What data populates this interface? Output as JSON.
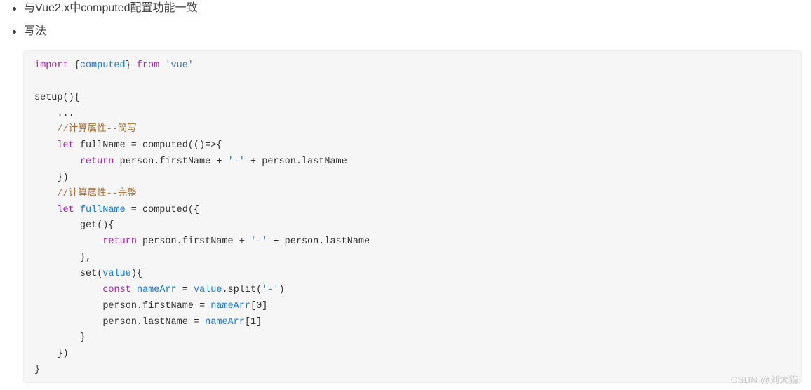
{
  "colors": {
    "page_background": "#ffffff",
    "code_background": "#f6f6f6",
    "code_border": "#eeeeee",
    "text": "#3f3f3f",
    "token_keyword": "#a626a4",
    "token_identifier": "#1a7bd4",
    "token_string": "#3d7ca8",
    "token_comment": "#a0703a",
    "token_plain": "#333333",
    "watermark": "#c9c9c9"
  },
  "notes": {
    "bullets": [
      "与Vue2.x中computed配置功能一致",
      "写法"
    ]
  },
  "code": {
    "language": "javascript",
    "raw": "import {computed} from 'vue'\n\nsetup(){\n    ...\n    //计算属性--简写\n    let fullName = computed(()=>{\n        return person.firstName + '-' + person.lastName\n    })\n    //计算属性--完整\n    let fullName = computed({\n        get(){\n            return person.firstName + '-' + person.lastName\n        },\n        set(value){\n            const nameArr = value.split('-')\n            person.firstName = nameArr[0]\n            person.lastName = nameArr[1]\n        }\n    })\n}",
    "lines": [
      {
        "n": 1,
        "text": "import {computed} from 'vue'"
      },
      {
        "n": 2,
        "text": ""
      },
      {
        "n": 3,
        "text": "setup(){"
      },
      {
        "n": 4,
        "text": "    ..."
      },
      {
        "n": 5,
        "text": "    //计算属性--简写"
      },
      {
        "n": 6,
        "text": "    let fullName = computed(()=>{"
      },
      {
        "n": 7,
        "text": "        return person.firstName + '-' + person.lastName"
      },
      {
        "n": 8,
        "text": "    })"
      },
      {
        "n": 9,
        "text": "    //计算属性--完整"
      },
      {
        "n": 10,
        "text": "    let fullName = computed({"
      },
      {
        "n": 11,
        "text": "        get(){"
      },
      {
        "n": 12,
        "text": "            return person.firstName + '-' + person.lastName"
      },
      {
        "n": 13,
        "text": "        },"
      },
      {
        "n": 14,
        "text": "        set(value){"
      },
      {
        "n": 15,
        "text": "            const nameArr = value.split('-')"
      },
      {
        "n": 16,
        "text": "            person.firstName = nameArr[0]"
      },
      {
        "n": 17,
        "text": "            person.lastName = nameArr[1]"
      },
      {
        "n": 18,
        "text": "        }"
      },
      {
        "n": 19,
        "text": "    })"
      },
      {
        "n": 20,
        "text": "}"
      }
    ]
  },
  "watermark": {
    "text": "CSDN @刘大猫."
  }
}
